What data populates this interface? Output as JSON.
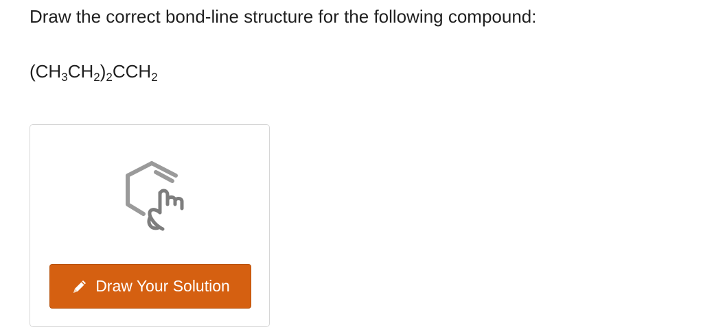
{
  "question": {
    "prompt": "Draw the correct bond-line structure for the following compound:",
    "formula_parts": {
      "p1": "(CH",
      "s1": "3",
      "p2": "CH",
      "s2": "2",
      "p3": ")",
      "s3": "2",
      "p4": "CCH",
      "s4": "2"
    }
  },
  "solution_card": {
    "icon": "molecule-draw-icon",
    "button": {
      "icon": "pencil-icon",
      "label": "Draw Your Solution",
      "color": "#d56011"
    }
  }
}
